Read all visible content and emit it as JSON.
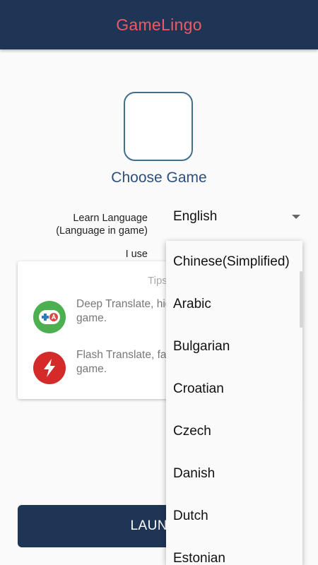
{
  "appbar": {
    "title": "GameLingo"
  },
  "game": {
    "choose_label": "Choose Game"
  },
  "settings": {
    "learn_label_line1": "Learn Language",
    "learn_label_line2": "(Language in game)",
    "learn_value": "English",
    "use_label": "I use"
  },
  "tips": {
    "title": "Tips",
    "items": [
      {
        "icon": "gamepad-translate-icon",
        "text": "Deep Translate, high quality and study for game."
      },
      {
        "icon": "lightning-icon",
        "text": "Flash Translate, fast during game-play for game."
      }
    ]
  },
  "launch": {
    "label": "LAUNCH"
  },
  "dropdown": {
    "options": [
      "Chinese(Simplified)",
      "Arabic",
      "Bulgarian",
      "Croatian",
      "Czech",
      "Danish",
      "Dutch",
      "Estonian"
    ]
  },
  "colors": {
    "appbar": "#1f3556",
    "title": "#ee5a64",
    "accent": "#2c4f7c",
    "tip_green": "#4caf50",
    "tip_red": "#d42a2a"
  }
}
